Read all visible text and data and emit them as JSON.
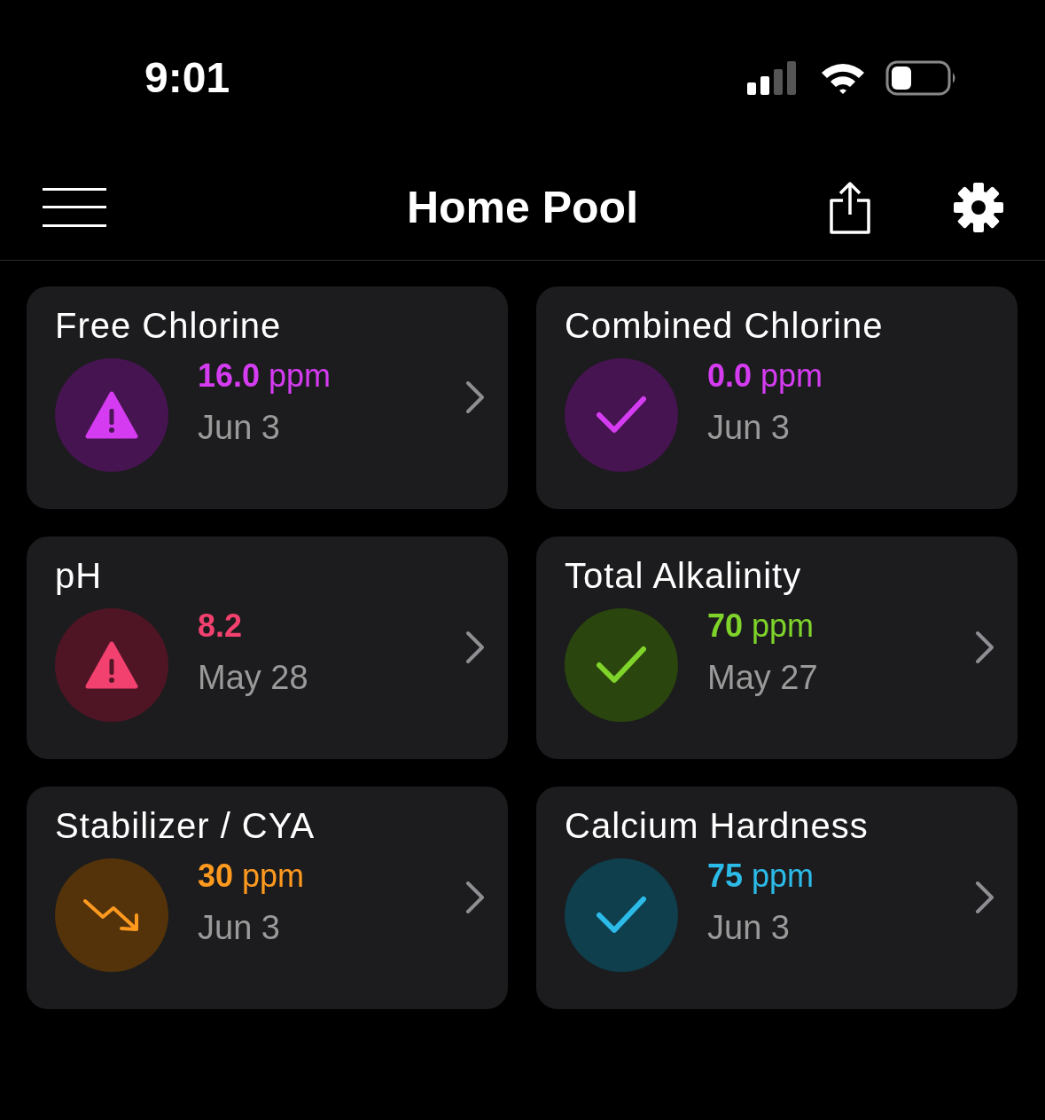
{
  "status_bar": {
    "time": "9:01"
  },
  "header": {
    "title": "Home Pool"
  },
  "cards": [
    {
      "title": "Free Chlorine",
      "value": "16.0",
      "unit": "ppm",
      "date": "Jun 3",
      "kind": "warning",
      "color": "#d53cf2",
      "chevron": true
    },
    {
      "title": "Combined Chlorine",
      "value": "0.0",
      "unit": "ppm",
      "date": "Jun 3",
      "kind": "ok",
      "color": "#d53cf2",
      "chevron": false
    },
    {
      "title": "pH",
      "value": "8.2",
      "date": "May 28",
      "kind": "warning",
      "color": "#f2416f",
      "chevron": true
    },
    {
      "title": "Total Alkalinity",
      "value": "70",
      "unit": "ppm",
      "date": "May 27",
      "kind": "ok",
      "color": "#7fd32a",
      "chevron": true
    },
    {
      "title": "Stabilizer / CYA",
      "value": "30",
      "unit": "ppm",
      "date": "Jun 3",
      "kind": "trend-down",
      "color": "#ff9a1f",
      "chevron": true
    },
    {
      "title": "Calcium Hardness",
      "value": "75",
      "unit": "ppm",
      "date": "Jun 3",
      "kind": "ok",
      "color": "#2cbbe8",
      "chevron": true
    }
  ]
}
